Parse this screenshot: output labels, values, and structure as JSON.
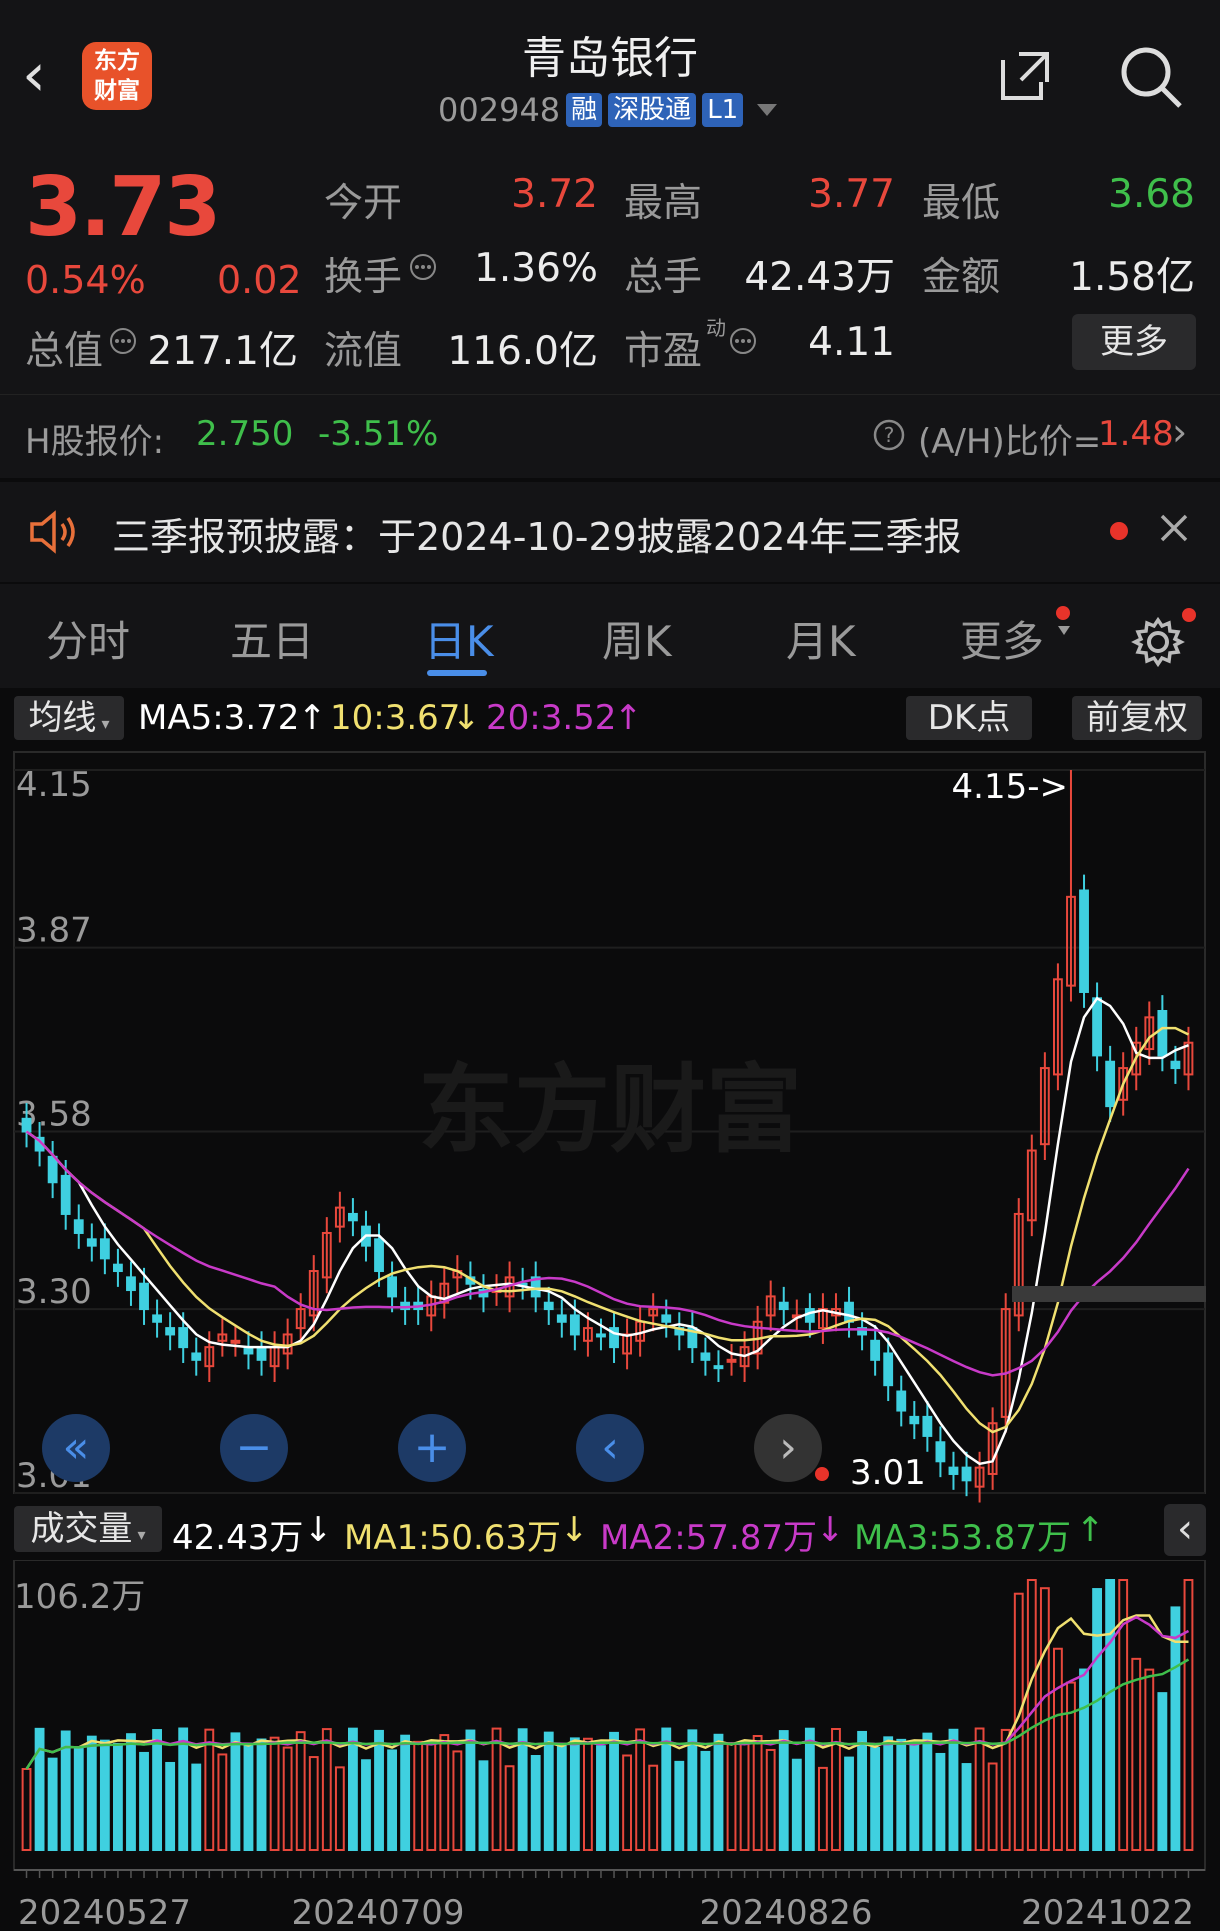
{
  "header": {
    "title": "青岛银行",
    "code": "002948",
    "tags": [
      "融",
      "深股通",
      "L1"
    ],
    "logo_text": "东方财富"
  },
  "quote": {
    "price": "3.73",
    "change_pct": "0.54%",
    "change": "0.02",
    "open_label": "今开",
    "open": "3.72",
    "high_label": "最高",
    "high": "3.77",
    "low_label": "最低",
    "low": "3.68",
    "turnover_label": "换手",
    "turnover": "1.36%",
    "volume_label": "总手",
    "volume": "42.43万",
    "amount_label": "金额",
    "amount": "1.58亿",
    "mktcap_label": "总值",
    "mktcap": "217.1亿",
    "float_label": "流值",
    "float": "116.0亿",
    "pe_label": "市盈",
    "pe_sup": "动",
    "pe": "4.11",
    "more": "更多"
  },
  "hshare": {
    "label": "H股报价:",
    "price": "2.750",
    "pct": "-3.51%",
    "ratio_label": "(A/H)比价=",
    "ratio": "1.48"
  },
  "notice": {
    "text": "三季报预披露：于2024-10-29披露2024年三季报"
  },
  "tabs": [
    "分时",
    "五日",
    "日K",
    "周K",
    "月K",
    "更多"
  ],
  "active_tab": "日K",
  "ma_bar": {
    "selector": "均线",
    "ma5_label": "MA5:3.72",
    "ma10_label": "10:3.67",
    "ma20_label": "20:3.52",
    "dk": "DK点",
    "adjust": "前复权"
  },
  "volume_bar": {
    "selector": "成交量",
    "vol": "42.43万",
    "ma1": "MA1:50.63万",
    "ma2": "MA2:57.87万",
    "ma3": "MA3:53.87万"
  },
  "colors": {
    "up": "#e8483c",
    "down": "#3fd0e0",
    "ma5": "#ffffff",
    "ma10": "#f0e070",
    "ma20": "#c83ac8",
    "vol_ma3": "#3fbf4b",
    "accent": "#4a8ee8"
  },
  "chart_data": {
    "type": "candlestick",
    "y_ticks": [
      "4.15",
      "3.87",
      "3.58",
      "3.30",
      "3.01"
    ],
    "ylim": [
      3.01,
      4.15
    ],
    "max_label": "4.15->",
    "min_label": "3.01",
    "x_labels": [
      "20240527",
      "20240709",
      "20240826",
      "20241022"
    ],
    "vol_max_label": "106.2万",
    "closes": [
      3.58,
      3.55,
      3.5,
      3.45,
      3.42,
      3.4,
      3.38,
      3.36,
      3.33,
      3.3,
      3.28,
      3.26,
      3.24,
      3.22,
      3.24,
      3.26,
      3.25,
      3.23,
      3.22,
      3.24,
      3.26,
      3.3,
      3.36,
      3.42,
      3.46,
      3.44,
      3.4,
      3.36,
      3.32,
      3.3,
      3.3,
      3.32,
      3.34,
      3.36,
      3.34,
      3.32,
      3.33,
      3.35,
      3.34,
      3.32,
      3.3,
      3.28,
      3.26,
      3.27,
      3.26,
      3.24,
      3.26,
      3.28,
      3.3,
      3.28,
      3.26,
      3.24,
      3.22,
      3.21,
      3.22,
      3.24,
      3.28,
      3.32,
      3.3,
      3.29,
      3.28,
      3.3,
      3.3,
      3.28,
      3.26,
      3.22,
      3.18,
      3.14,
      3.12,
      3.1,
      3.06,
      3.04,
      3.03,
      3.05,
      3.12,
      3.3,
      3.45,
      3.55,
      3.68,
      3.82,
      3.95,
      3.8,
      3.7,
      3.62,
      3.68,
      3.72,
      3.76,
      3.7,
      3.68,
      3.72
    ],
    "ma5_shown": "3.72",
    "ma10_shown": "3.67",
    "ma20_shown": "3.52"
  }
}
